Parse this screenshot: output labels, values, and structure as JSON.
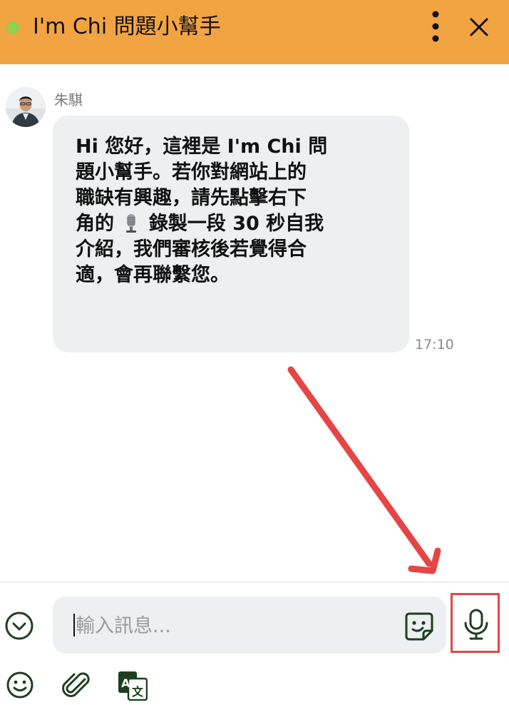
{
  "header": {
    "title": "I'm Chi 問題小幫手",
    "status": "online",
    "more_icon": "more-vertical-icon",
    "close_icon": "close-icon"
  },
  "message": {
    "sender": "朱騏",
    "avatar_icon": "user-avatar",
    "lines": [
      "Hi 您好，這裡是 I'm Chi 問",
      "題小幫手。若你對網站上的",
      "職缺有興趣，請先點擊右下",
      "角的",
      "錄製一段 30 秒自我",
      "介紹，我們審核後若覺得合",
      "適，會再聯繫您。"
    ],
    "inline_icon": "microphone-emoji",
    "time": "17:10"
  },
  "composer": {
    "placeholder": "輸入訊息...",
    "collapse_icon": "chevron-down-circle-icon",
    "sticker_icon": "sticker-icon",
    "mic_icon": "microphone-icon",
    "emoji_icon": "smiley-icon",
    "attach_icon": "paperclip-icon",
    "translate_icon": "translate-icon"
  },
  "colors": {
    "header": "#f2a443",
    "online": "#8fd14f",
    "bubble": "#eeeff1",
    "annotation": "#e64545",
    "icon": "#1f3d1f"
  }
}
